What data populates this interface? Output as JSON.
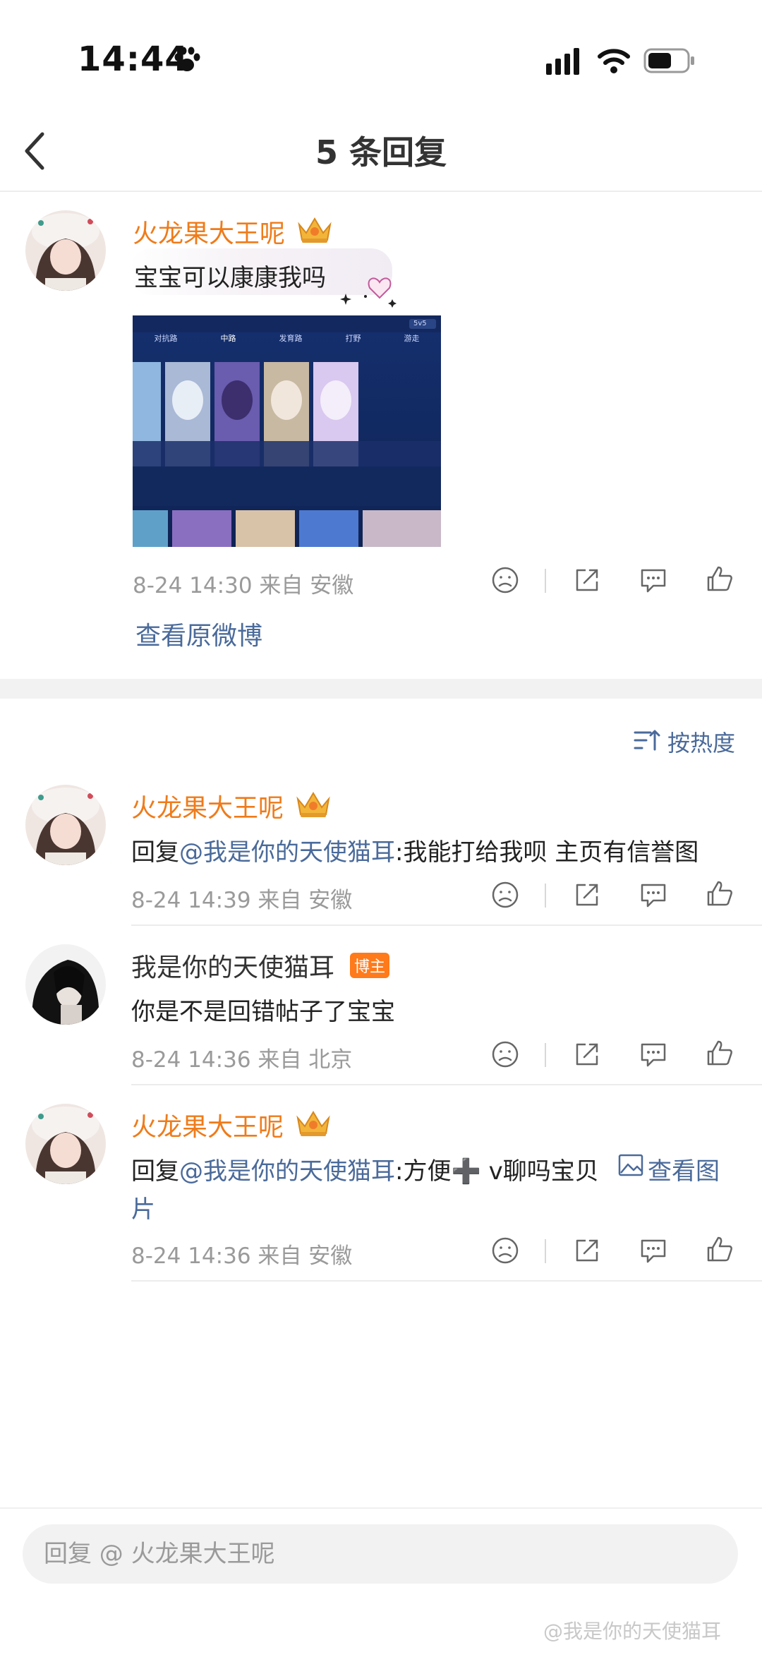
{
  "status_bar": {
    "time": "14:44"
  },
  "nav": {
    "title": "5 条回复"
  },
  "main_post": {
    "author": "火龙果大王呢",
    "text": "宝宝可以康康我吗",
    "meta": "8-24 14:30 来自 安徽",
    "view_original": "查看原微博",
    "image_tabs": [
      "对抗路",
      "中路",
      "发育路",
      "打野",
      "游走"
    ],
    "image_mode": "5v5"
  },
  "sort": {
    "label": "按热度"
  },
  "replies": [
    {
      "author": "火龙果大王呢",
      "prefix": "回复",
      "mention": "@我是你的天使猫耳",
      "text": ":我能打给我呗 主页有信誉图",
      "meta": "8-24 14:39 来自 安徽"
    },
    {
      "author": "我是你的天使猫耳",
      "badge": "博主",
      "text": "你是不是回错帖子了宝宝",
      "meta": "8-24 14:36 来自 北京"
    },
    {
      "author": "火龙果大王呢",
      "prefix": "回复",
      "mention": "@我是你的天使猫耳",
      "text": ":方便➕ v聊吗宝贝",
      "view_image": "查看图",
      "text_line2": "片",
      "meta": "8-24 14:36 来自 安徽"
    }
  ],
  "reply_bar": {
    "placeholder": "回复 @ 火龙果大王呢"
  },
  "watermark": "@我是你的天使猫耳",
  "colors": {
    "author_orange": "#ef7b1a",
    "link_blue": "#4a6a9a",
    "meta_gray": "#9a9a9a"
  }
}
